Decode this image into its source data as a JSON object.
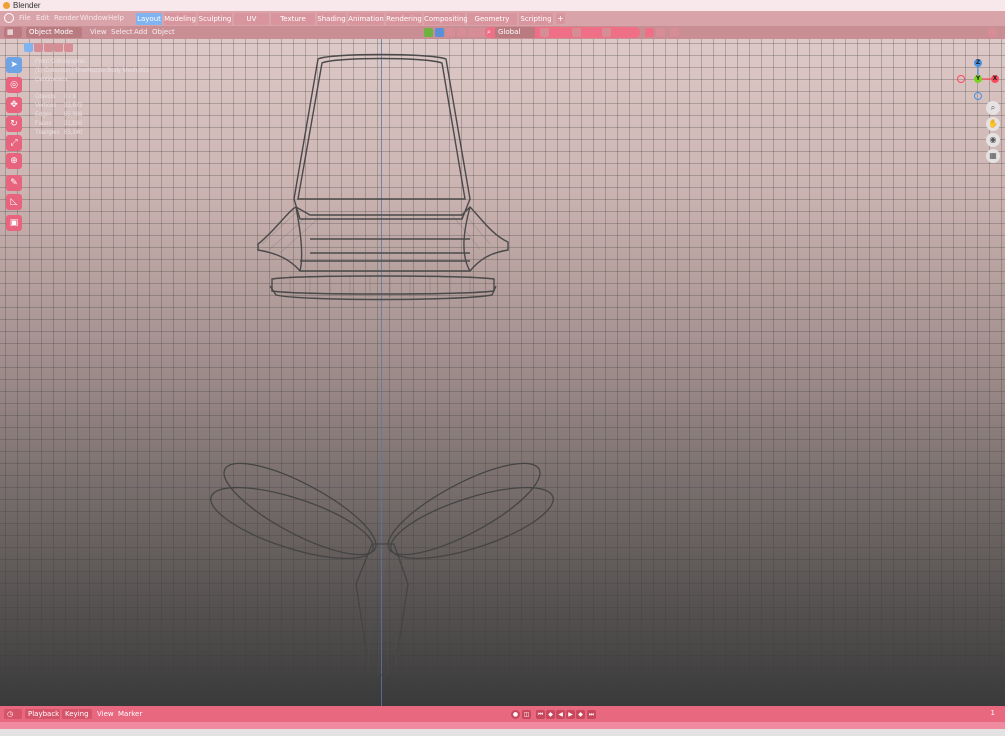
{
  "window": {
    "title": "Blender"
  },
  "menu": {
    "items": [
      "File",
      "Edit",
      "Render",
      "Window",
      "Help"
    ]
  },
  "workspaces": {
    "tabs": [
      "Layout",
      "Modeling",
      "Sculpting",
      "UV Editing",
      "Texture Paint",
      "Shading",
      "Animation",
      "Rendering",
      "Compositing",
      "Geometry Nodes",
      "Scripting"
    ],
    "active": "Layout",
    "add_label": "+"
  },
  "viewport_header": {
    "mode": "Object Mode",
    "menus": [
      "View",
      "Select",
      "Add",
      "Object"
    ],
    "transform_orientation": "Global",
    "search_value": ""
  },
  "overlay": {
    "view_name": "Front Orthographic",
    "collection_path": "(1) Collection | BlueNozzle:Body Mesh.001",
    "units": "Centimeters",
    "stats": [
      {
        "label": "Objects",
        "value": "0 / 3"
      },
      {
        "label": "Vertices",
        "value": "33,973"
      },
      {
        "label": "Edges",
        "value": "65,888"
      },
      {
        "label": "Faces",
        "value": "31,838"
      },
      {
        "label": "Triangles",
        "value": "63,240"
      }
    ]
  },
  "toolbar": {
    "tools": [
      "select-box",
      "cursor",
      "move",
      "rotate",
      "scale",
      "transform",
      "annotate",
      "measure",
      "add-cube"
    ],
    "active": "select-box"
  },
  "gizmo": {
    "axes": [
      "Z",
      "Y",
      "X"
    ]
  },
  "timeline": {
    "playback_label": "Playback",
    "keying_label": "Keying",
    "menus": [
      "View",
      "Marker"
    ],
    "current_frame": "1"
  },
  "colors": {
    "accent": "#e8697f",
    "active_blue": "#6ea3e6",
    "topbar": "#d9a4a9",
    "gizmo_x": "#ff4a5f",
    "gizmo_y": "#7ed321",
    "gizmo_z": "#4a90e2"
  }
}
